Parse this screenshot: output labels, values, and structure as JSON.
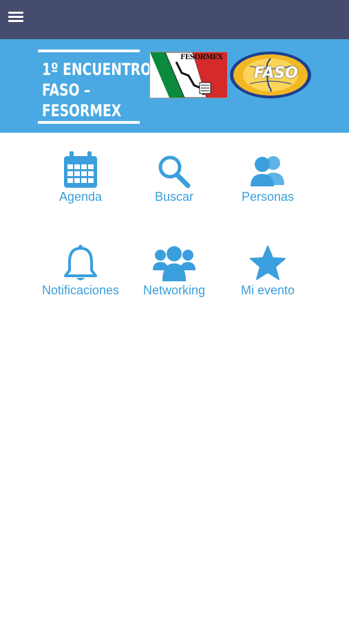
{
  "header": {
    "menu_icon": "hamburger-menu-icon",
    "color": "#454c6e"
  },
  "banner": {
    "title_line1": "1º ENCUENTRO",
    "title_line2": "FASO –",
    "title_line3": "FESORMEX",
    "logo1_text": "FESORMEX",
    "logo2_text": "FASO",
    "color": "#4aa9e2"
  },
  "menu": {
    "accent_color": "#3a9fdc",
    "items": [
      {
        "label": "Agenda",
        "icon": "calendar-icon"
      },
      {
        "label": "Buscar",
        "icon": "search-icon"
      },
      {
        "label": "Personas",
        "icon": "people-icon"
      },
      {
        "label": "Notificaciones",
        "icon": "bell-icon"
      },
      {
        "label": "Networking",
        "icon": "group-icon"
      },
      {
        "label": "Mi evento",
        "icon": "star-icon"
      }
    ]
  }
}
